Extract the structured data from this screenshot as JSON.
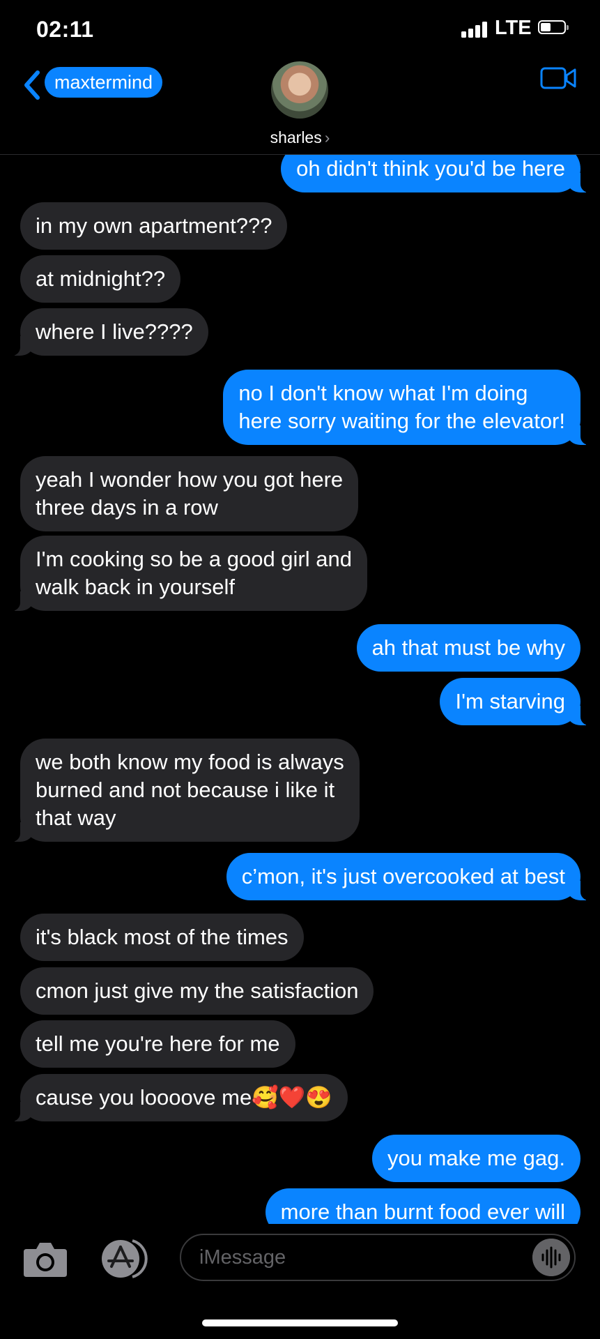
{
  "status_bar": {
    "time": "02:11",
    "network": "LTE",
    "battery_level": 0.45
  },
  "header": {
    "back_label": "maxtermind",
    "contact_name": "sharles",
    "contact_chevron": "›",
    "icons": {
      "back": "chevron-left-icon",
      "video": "video-camera-icon",
      "avatar": "contact-photo"
    }
  },
  "messages": [
    {
      "from": "me",
      "text": "oh didn't think you'd be here"
    },
    {
      "from": "them",
      "text": "in my own apartment???"
    },
    {
      "from": "them",
      "text": "at midnight??"
    },
    {
      "from": "them",
      "text": "where I live????"
    },
    {
      "from": "me",
      "lines": [
        "no I don't know what I'm doing",
        "here sorry waiting for the elevator!"
      ]
    },
    {
      "from": "them",
      "lines": [
        "yeah I wonder how you got here",
        "three days in a row"
      ]
    },
    {
      "from": "them",
      "lines": [
        "I'm cooking so be a good girl and",
        "walk back in yourself"
      ]
    },
    {
      "from": "me",
      "text": "ah that must be why"
    },
    {
      "from": "me",
      "text": "I'm starving"
    },
    {
      "from": "them",
      "lines": [
        "we both know my food is always",
        "burned and not because i like it",
        "that way"
      ]
    },
    {
      "from": "me",
      "text": "c’mon, it's just overcooked at best"
    },
    {
      "from": "them",
      "text": "it's black most of the times"
    },
    {
      "from": "them",
      "text": "cmon just give my the satisfaction"
    },
    {
      "from": "them",
      "text": "tell me you're here for me"
    },
    {
      "from": "them",
      "text": "cause you loooove me🥰❤️😍"
    },
    {
      "from": "me",
      "text": "you make me gag."
    },
    {
      "from": "me",
      "text": "more than burnt food ever will"
    }
  ],
  "composer": {
    "placeholder": "iMessage",
    "icons": {
      "camera": "camera-icon",
      "apps": "app-store-icon",
      "audio": "audio-waveform-icon"
    }
  },
  "colors": {
    "outgoing": "#0a84ff",
    "incoming": "#262629",
    "background": "#000000"
  }
}
